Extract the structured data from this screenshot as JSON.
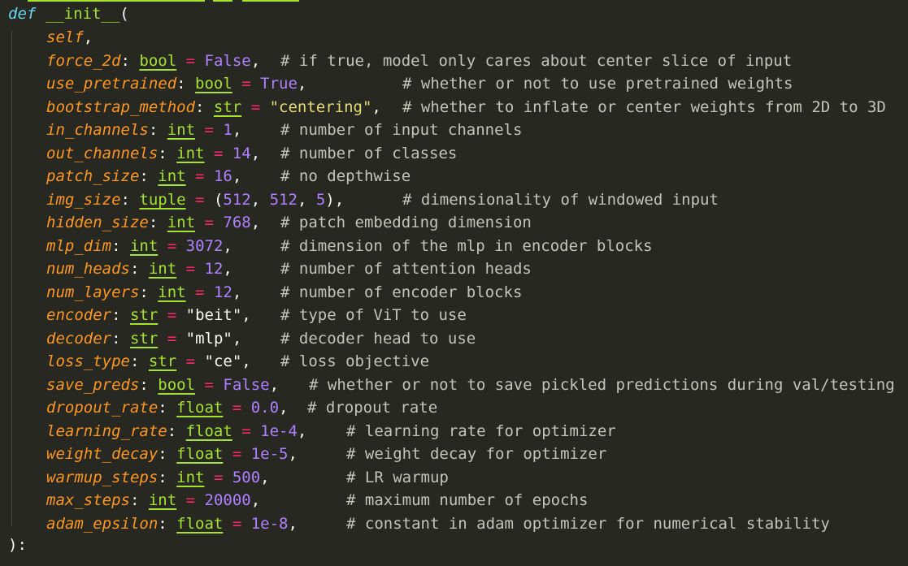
{
  "header": {
    "kw": "def",
    "fn": "__init__",
    "open": "("
  },
  "footer": {
    "close": "):"
  },
  "params": [
    {
      "name": "self",
      "type": "",
      "value": "",
      "vclass": "",
      "comment": "",
      "commentCol": 0
    },
    {
      "name": "force_2d",
      "type": "bool",
      "value": "False",
      "vclass": "const",
      "comment": "# if true, model only cares about center slice of input",
      "commentCol": 345
    },
    {
      "name": "use_pretrained",
      "type": "bool",
      "value": "True",
      "vclass": "const",
      "comment": "# whether or not to use pretrained weights",
      "commentCol": 495
    },
    {
      "name": "bootstrap_method",
      "type": "str",
      "value": "\"centering\"",
      "vclass": "str",
      "comment": "# whether to inflate or center weights from 2D to 3D",
      "commentCol": 495
    },
    {
      "name": "in_channels",
      "type": "int",
      "value": "1",
      "vclass": "num",
      "comment": "# number of input channels",
      "commentCol": 345
    },
    {
      "name": "out_channels",
      "type": "int",
      "value": "14",
      "vclass": "num",
      "comment": "# number of classes",
      "commentCol": 345
    },
    {
      "name": "patch_size",
      "type": "int",
      "value": "16",
      "vclass": "num",
      "comment": "# no depthwise",
      "commentCol": 345
    },
    {
      "name": "img_size",
      "type": "tuple",
      "value": "(512, 512, 5)",
      "vclass": "tuple",
      "comment": "# dimensionality of windowed input",
      "commentCol": 495
    },
    {
      "name": "hidden_size",
      "type": "int",
      "value": "768",
      "vclass": "num",
      "comment": "# patch embedding dimension",
      "commentCol": 345
    },
    {
      "name": "mlp_dim",
      "type": "int",
      "value": "3072",
      "vclass": "num",
      "comment": "# dimension of the mlp in encoder blocks",
      "commentCol": 345
    },
    {
      "name": "num_heads",
      "type": "int",
      "value": "12",
      "vclass": "num",
      "comment": "# number of attention heads",
      "commentCol": 345
    },
    {
      "name": "num_layers",
      "type": "int",
      "value": "12",
      "vclass": "num",
      "comment": "# number of encoder blocks",
      "commentCol": 345
    },
    {
      "name": "encoder",
      "type": "str",
      "value": "\"beit\"",
      "vclass": "strw",
      "comment": "# type of ViT to use",
      "commentCol": 345
    },
    {
      "name": "decoder",
      "type": "str",
      "value": "\"mlp\"",
      "vclass": "strw",
      "comment": "# decoder head to use",
      "commentCol": 345
    },
    {
      "name": "loss_type",
      "type": "str",
      "value": "\"ce\"",
      "vclass": "strw",
      "comment": "# loss objective",
      "commentCol": 345
    },
    {
      "name": "save_preds",
      "type": "bool",
      "value": "False",
      "vclass": "const",
      "comment": "# whether or not to save pickled predictions during val/testing",
      "commentCol": 380
    },
    {
      "name": "dropout_rate",
      "type": "float",
      "value": "0.0",
      "vclass": "num",
      "comment": "# dropout rate",
      "commentCol": 378
    },
    {
      "name": "learning_rate",
      "type": "float",
      "value": "1e-4",
      "vclass": "num",
      "comment": "# learning rate for optimizer",
      "commentCol": 426
    },
    {
      "name": "weight_decay",
      "type": "float",
      "value": "1e-5",
      "vclass": "num",
      "comment": "# weight decay for optimizer",
      "commentCol": 426
    },
    {
      "name": "warmup_steps",
      "type": "int",
      "value": "500",
      "vclass": "num",
      "comment": "# LR warmup",
      "commentCol": 426
    },
    {
      "name": "max_steps",
      "type": "int",
      "value": "20000",
      "vclass": "num",
      "comment": "# maximum number of epochs",
      "commentCol": 426
    },
    {
      "name": "adam_epsilon",
      "type": "float",
      "value": "1e-8",
      "vclass": "num",
      "comment": "# constant in adam optimizer for numerical stability",
      "commentCol": 426
    }
  ],
  "colors": {
    "background": "#272822",
    "keyword": "#66d9ef",
    "function": "#a6e22e",
    "parameter": "#fd971f",
    "operator": "#f92672",
    "number": "#ae81ff",
    "string": "#e6db74",
    "comment": "#c4c4b8"
  }
}
